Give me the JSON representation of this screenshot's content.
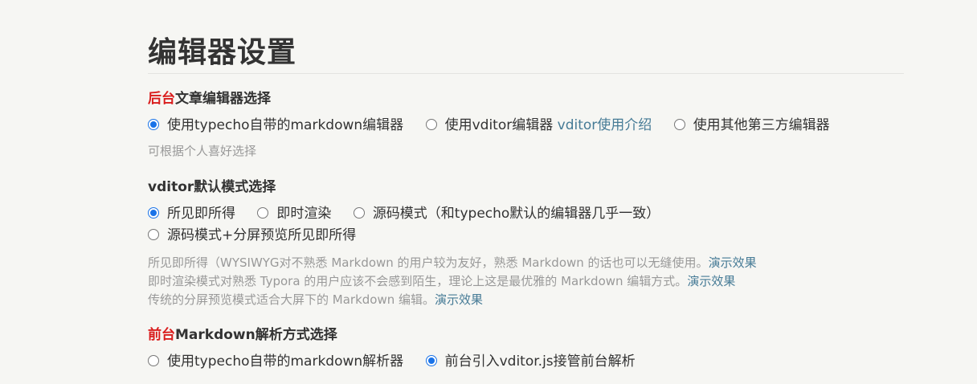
{
  "page": {
    "title": "编辑器设置"
  },
  "backend_editor": {
    "title_accent": "后台",
    "title_rest": "文章编辑器选择",
    "options": [
      {
        "label": "使用typecho自带的markdown编辑器",
        "checked": true
      },
      {
        "label": "使用vditor编辑器",
        "link": "vditor使用介绍",
        "checked": false
      },
      {
        "label": "使用其他第三方编辑器",
        "checked": false
      }
    ],
    "description": "可根据个人喜好选择"
  },
  "vditor_mode": {
    "title": "vditor默认模式选择",
    "options": [
      {
        "label": "所见即所得",
        "checked": true
      },
      {
        "label": "即时渲染",
        "checked": false
      },
      {
        "label": "源码模式（和typecho默认的编辑器几乎一致）",
        "checked": false
      },
      {
        "label": "源码模式+分屏预览所见即所得",
        "checked": false
      }
    ],
    "descriptions": [
      {
        "text": "所见即所得（WYSIWYG对不熟悉 Markdown 的用户较为友好，熟悉 Markdown 的话也可以无缝使用。",
        "link": "演示效果"
      },
      {
        "text": "即时渲染模式对熟悉 Typora 的用户应该不会感到陌生，理论上这是最优雅的 Markdown 编辑方式。",
        "link": "演示效果"
      },
      {
        "text": "传统的分屏预览模式适合大屏下的 Markdown 编辑。",
        "link": "演示效果"
      }
    ]
  },
  "frontend_parser": {
    "title_accent": "前台",
    "title_rest": "Markdown解析方式选择",
    "options": [
      {
        "label": "使用typecho自带的markdown解析器",
        "checked": false
      },
      {
        "label": "前台引入vditor.js接管前台解析",
        "checked": true
      }
    ]
  },
  "colors": {
    "background": "#f6f6f3",
    "text": "#333333",
    "accent_red": "#d91c1c",
    "link": "#467b96",
    "muted": "#999999",
    "radio_checked": "#1a73e8"
  }
}
